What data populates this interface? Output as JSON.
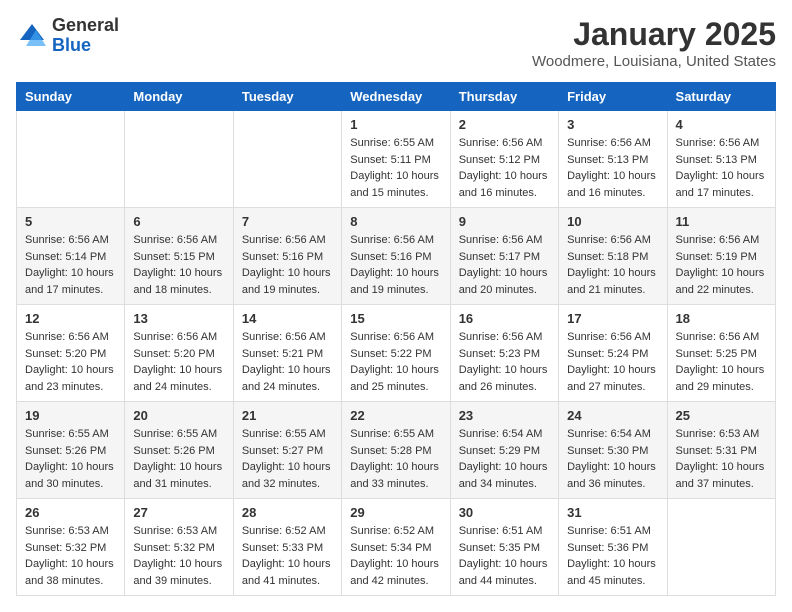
{
  "header": {
    "logo_general": "General",
    "logo_blue": "Blue",
    "month_title": "January 2025",
    "location": "Woodmere, Louisiana, United States"
  },
  "days_of_week": [
    "Sunday",
    "Monday",
    "Tuesday",
    "Wednesday",
    "Thursday",
    "Friday",
    "Saturday"
  ],
  "weeks": [
    [
      {
        "day": "",
        "info": ""
      },
      {
        "day": "",
        "info": ""
      },
      {
        "day": "",
        "info": ""
      },
      {
        "day": "1",
        "sunrise": "6:55 AM",
        "sunset": "5:11 PM",
        "daylight": "10 hours and 15 minutes."
      },
      {
        "day": "2",
        "sunrise": "6:56 AM",
        "sunset": "5:12 PM",
        "daylight": "10 hours and 16 minutes."
      },
      {
        "day": "3",
        "sunrise": "6:56 AM",
        "sunset": "5:13 PM",
        "daylight": "10 hours and 16 minutes."
      },
      {
        "day": "4",
        "sunrise": "6:56 AM",
        "sunset": "5:13 PM",
        "daylight": "10 hours and 17 minutes."
      }
    ],
    [
      {
        "day": "5",
        "sunrise": "6:56 AM",
        "sunset": "5:14 PM",
        "daylight": "10 hours and 17 minutes."
      },
      {
        "day": "6",
        "sunrise": "6:56 AM",
        "sunset": "5:15 PM",
        "daylight": "10 hours and 18 minutes."
      },
      {
        "day": "7",
        "sunrise": "6:56 AM",
        "sunset": "5:16 PM",
        "daylight": "10 hours and 19 minutes."
      },
      {
        "day": "8",
        "sunrise": "6:56 AM",
        "sunset": "5:16 PM",
        "daylight": "10 hours and 19 minutes."
      },
      {
        "day": "9",
        "sunrise": "6:56 AM",
        "sunset": "5:17 PM",
        "daylight": "10 hours and 20 minutes."
      },
      {
        "day": "10",
        "sunrise": "6:56 AM",
        "sunset": "5:18 PM",
        "daylight": "10 hours and 21 minutes."
      },
      {
        "day": "11",
        "sunrise": "6:56 AM",
        "sunset": "5:19 PM",
        "daylight": "10 hours and 22 minutes."
      }
    ],
    [
      {
        "day": "12",
        "sunrise": "6:56 AM",
        "sunset": "5:20 PM",
        "daylight": "10 hours and 23 minutes."
      },
      {
        "day": "13",
        "sunrise": "6:56 AM",
        "sunset": "5:20 PM",
        "daylight": "10 hours and 24 minutes."
      },
      {
        "day": "14",
        "sunrise": "6:56 AM",
        "sunset": "5:21 PM",
        "daylight": "10 hours and 24 minutes."
      },
      {
        "day": "15",
        "sunrise": "6:56 AM",
        "sunset": "5:22 PM",
        "daylight": "10 hours and 25 minutes."
      },
      {
        "day": "16",
        "sunrise": "6:56 AM",
        "sunset": "5:23 PM",
        "daylight": "10 hours and 26 minutes."
      },
      {
        "day": "17",
        "sunrise": "6:56 AM",
        "sunset": "5:24 PM",
        "daylight": "10 hours and 27 minutes."
      },
      {
        "day": "18",
        "sunrise": "6:56 AM",
        "sunset": "5:25 PM",
        "daylight": "10 hours and 29 minutes."
      }
    ],
    [
      {
        "day": "19",
        "sunrise": "6:55 AM",
        "sunset": "5:26 PM",
        "daylight": "10 hours and 30 minutes."
      },
      {
        "day": "20",
        "sunrise": "6:55 AM",
        "sunset": "5:26 PM",
        "daylight": "10 hours and 31 minutes."
      },
      {
        "day": "21",
        "sunrise": "6:55 AM",
        "sunset": "5:27 PM",
        "daylight": "10 hours and 32 minutes."
      },
      {
        "day": "22",
        "sunrise": "6:55 AM",
        "sunset": "5:28 PM",
        "daylight": "10 hours and 33 minutes."
      },
      {
        "day": "23",
        "sunrise": "6:54 AM",
        "sunset": "5:29 PM",
        "daylight": "10 hours and 34 minutes."
      },
      {
        "day": "24",
        "sunrise": "6:54 AM",
        "sunset": "5:30 PM",
        "daylight": "10 hours and 36 minutes."
      },
      {
        "day": "25",
        "sunrise": "6:53 AM",
        "sunset": "5:31 PM",
        "daylight": "10 hours and 37 minutes."
      }
    ],
    [
      {
        "day": "26",
        "sunrise": "6:53 AM",
        "sunset": "5:32 PM",
        "daylight": "10 hours and 38 minutes."
      },
      {
        "day": "27",
        "sunrise": "6:53 AM",
        "sunset": "5:32 PM",
        "daylight": "10 hours and 39 minutes."
      },
      {
        "day": "28",
        "sunrise": "6:52 AM",
        "sunset": "5:33 PM",
        "daylight": "10 hours and 41 minutes."
      },
      {
        "day": "29",
        "sunrise": "6:52 AM",
        "sunset": "5:34 PM",
        "daylight": "10 hours and 42 minutes."
      },
      {
        "day": "30",
        "sunrise": "6:51 AM",
        "sunset": "5:35 PM",
        "daylight": "10 hours and 44 minutes."
      },
      {
        "day": "31",
        "sunrise": "6:51 AM",
        "sunset": "5:36 PM",
        "daylight": "10 hours and 45 minutes."
      },
      {
        "day": "",
        "info": ""
      }
    ]
  ],
  "labels": {
    "sunrise": "Sunrise:",
    "sunset": "Sunset:",
    "daylight": "Daylight:"
  }
}
